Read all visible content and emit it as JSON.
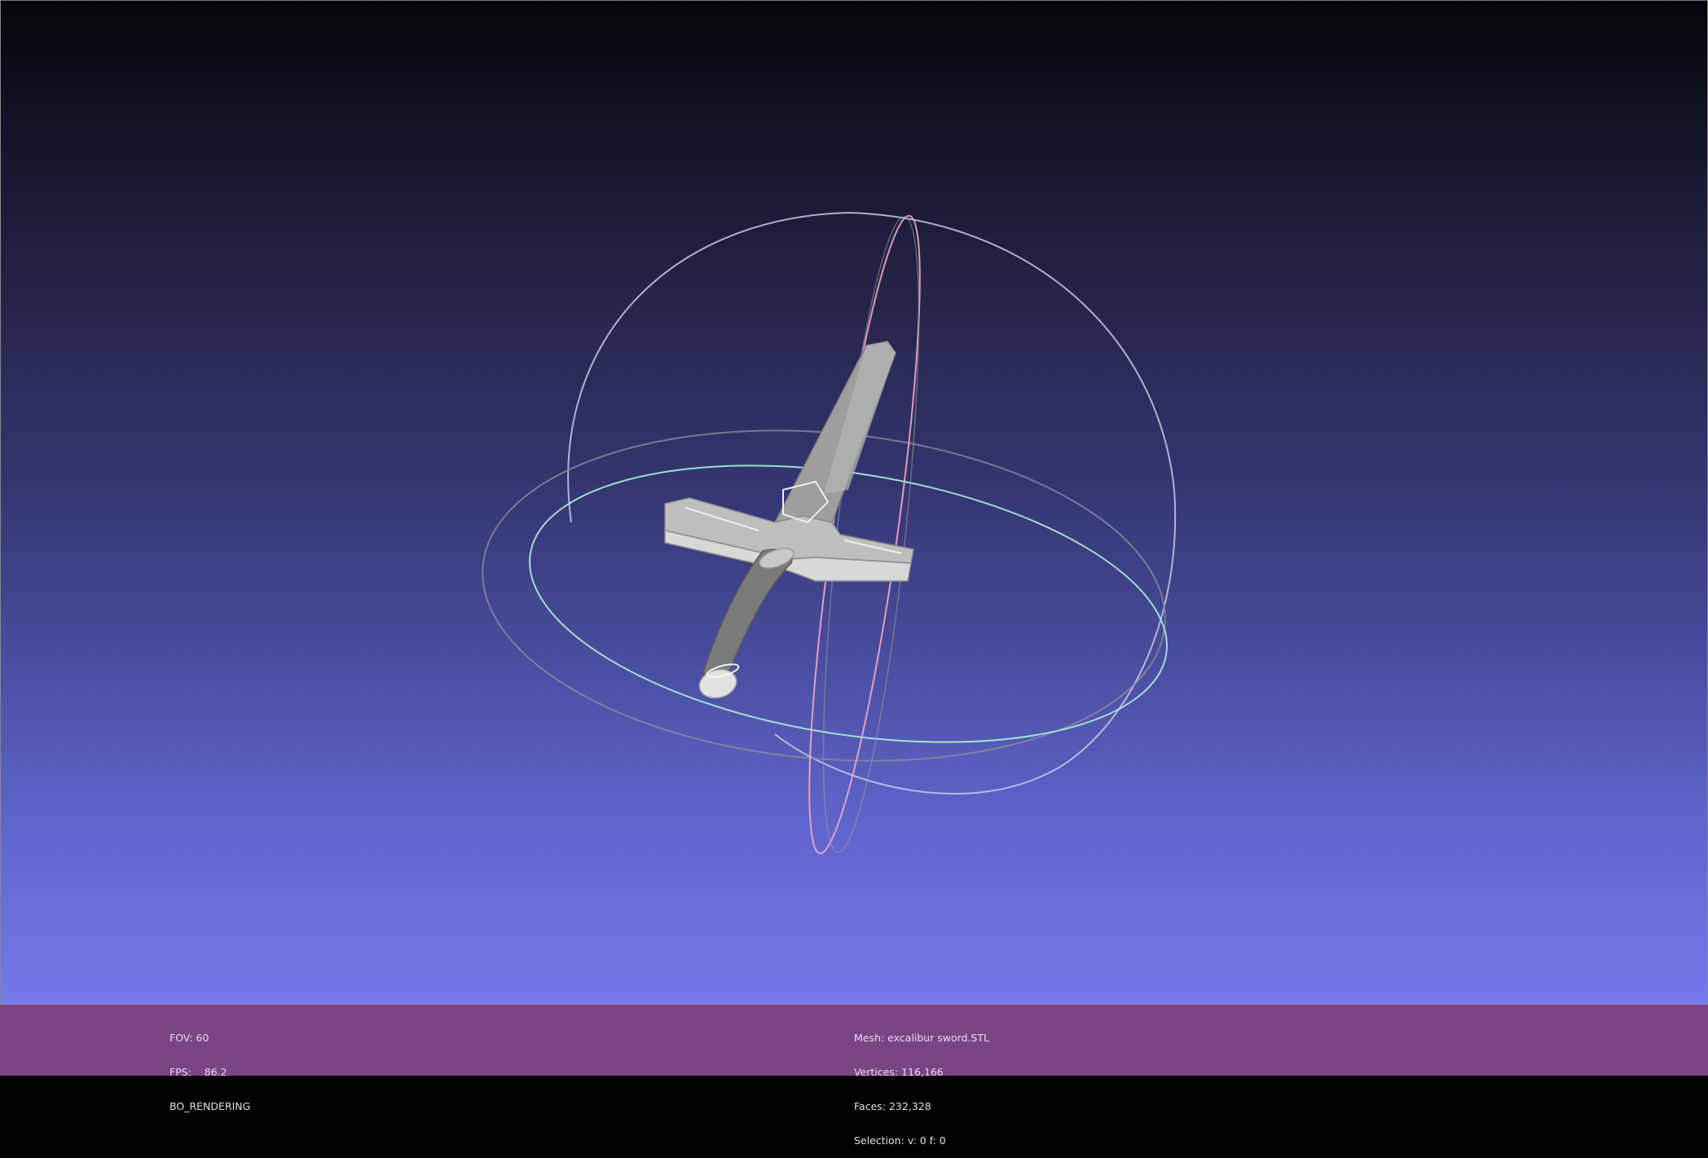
{
  "viewer": {
    "left_info": {
      "fov": "FOV: 60",
      "fps": "FPS:    86.2",
      "mode": "BO_RENDERING"
    },
    "right_info": {
      "mesh": "Mesh: excalibur sword.STL",
      "vertices": "Vertices: 116,166",
      "faces": "Faces: 232,328",
      "selection": "Selection: v: 0 f: 0"
    }
  },
  "colors": {
    "info_bar": "#7b4484",
    "trackball_horizontal": "#a9f0d8",
    "trackball_vertical": "#f0a8c8",
    "trackball_outer": "#c8c8e8",
    "mesh": "#bdbdbd"
  },
  "icons": {
    "trackball": "trackball-gizmo",
    "model": "sword-mesh"
  }
}
